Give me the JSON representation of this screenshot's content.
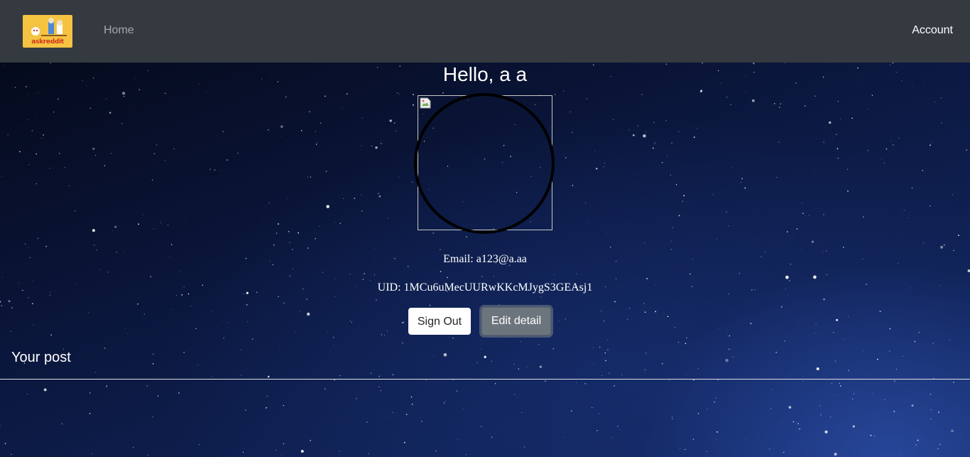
{
  "navbar": {
    "logo_text": "askreddit",
    "home_label": "Home",
    "account_label": "Account",
    "bg_color": "#343a40"
  },
  "profile": {
    "greeting": "Hello, a a",
    "avatar_icon": "broken-image-icon",
    "email_line": "Email: a123@a.aa",
    "uid_line": "UID: 1MCu6uMecUURwKKcMJygS3GEAsj1"
  },
  "actions": {
    "sign_out_label": "Sign Out",
    "edit_label": "Edit detail"
  },
  "posts": {
    "heading": "Your post"
  },
  "colors": {
    "sky_top": "#050a1c",
    "sky_bottom": "#142a66",
    "edit_button": "#6c757d"
  }
}
